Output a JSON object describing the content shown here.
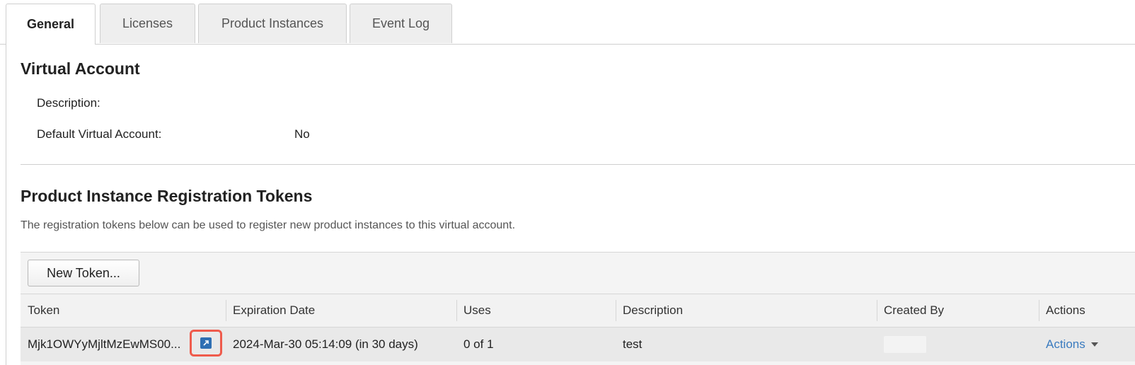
{
  "tabs": [
    {
      "label": "General",
      "active": true
    },
    {
      "label": "Licenses",
      "active": false
    },
    {
      "label": "Product Instances",
      "active": false
    },
    {
      "label": "Event Log",
      "active": false
    }
  ],
  "virtual_account": {
    "heading": "Virtual Account",
    "description_label": "Description:",
    "description_value": "",
    "default_label": "Default Virtual Account:",
    "default_value": "No"
  },
  "tokens_section": {
    "heading": "Product Instance Registration Tokens",
    "description": "The registration tokens below can be used to register new product instances to this virtual account.",
    "new_token_label": "New Token...",
    "columns": [
      "Token",
      "Expiration Date",
      "Uses",
      "Description",
      "Created By",
      "Actions"
    ],
    "rows": [
      {
        "token": "Mjk1OWYyMjltMzEwMS00...",
        "expiration": "2024-Mar-30 05:14:09 (in 30 days)",
        "uses": "0 of 1",
        "description": "test",
        "created_by": "",
        "actions_label": "Actions"
      }
    ]
  },
  "icons": {
    "copy": "copy-token-icon",
    "actions_caret": "chevron-down-icon"
  },
  "colors": {
    "link": "#3a7bbf",
    "highlight": "#ef5b4c",
    "copy_icon": "#2f6fb3"
  }
}
